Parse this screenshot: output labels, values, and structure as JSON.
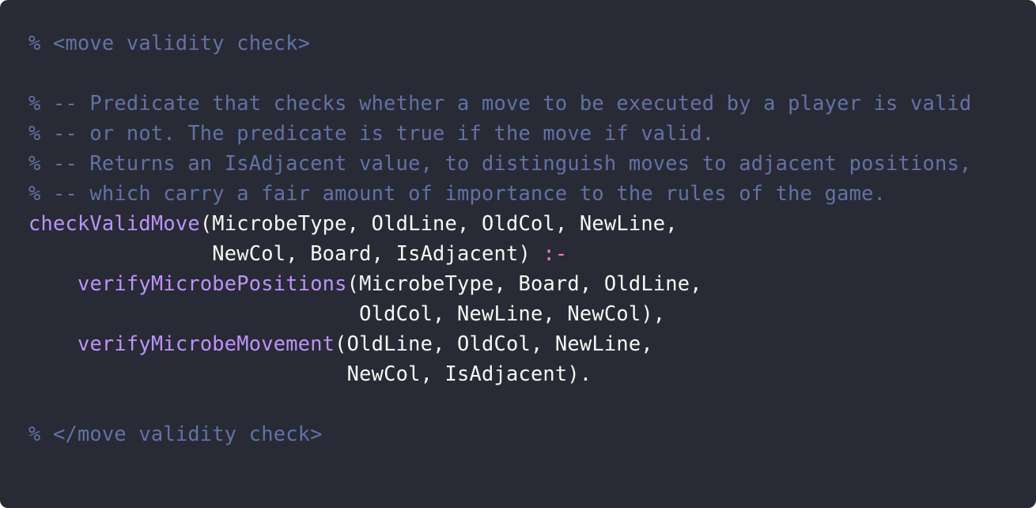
{
  "colors": {
    "background": "#282a36",
    "comment": "#6272a4",
    "function": "#bd93f9",
    "text": "#f8f8f2",
    "operator": "#ff79c6"
  },
  "code": {
    "language": "prolog",
    "lines": [
      [
        {
          "type": "comment",
          "text": "% <move validity check>"
        }
      ],
      [],
      [
        {
          "type": "comment",
          "text": "% -- Predicate that checks whether a move to be executed by a player is valid"
        }
      ],
      [
        {
          "type": "comment",
          "text": "% -- or not. The predicate is true if the move if valid."
        }
      ],
      [
        {
          "type": "comment",
          "text": "% -- Returns an IsAdjacent value, to distinguish moves to adjacent positions,"
        }
      ],
      [
        {
          "type": "comment",
          "text": "% -- which carry a fair amount of importance to the rules of the game."
        }
      ],
      [
        {
          "type": "func",
          "text": "checkValidMove"
        },
        {
          "type": "plain",
          "text": "(MicrobeType, OldLine, OldCol, NewLine,"
        }
      ],
      [
        {
          "type": "plain",
          "text": "               NewCol, Board, IsAdjacent) "
        },
        {
          "type": "op",
          "text": ":-"
        }
      ],
      [
        {
          "type": "plain",
          "text": "    "
        },
        {
          "type": "func",
          "text": "verifyMicrobePositions"
        },
        {
          "type": "plain",
          "text": "(MicrobeType, Board, OldLine,"
        }
      ],
      [
        {
          "type": "plain",
          "text": "                           OldCol, NewLine, NewCol),"
        }
      ],
      [
        {
          "type": "plain",
          "text": "    "
        },
        {
          "type": "func",
          "text": "verifyMicrobeMovement"
        },
        {
          "type": "plain",
          "text": "(OldLine, OldCol, NewLine,"
        }
      ],
      [
        {
          "type": "plain",
          "text": "                          NewCol, IsAdjacent)."
        }
      ],
      [],
      [
        {
          "type": "comment",
          "text": "% </move validity check>"
        }
      ]
    ]
  }
}
